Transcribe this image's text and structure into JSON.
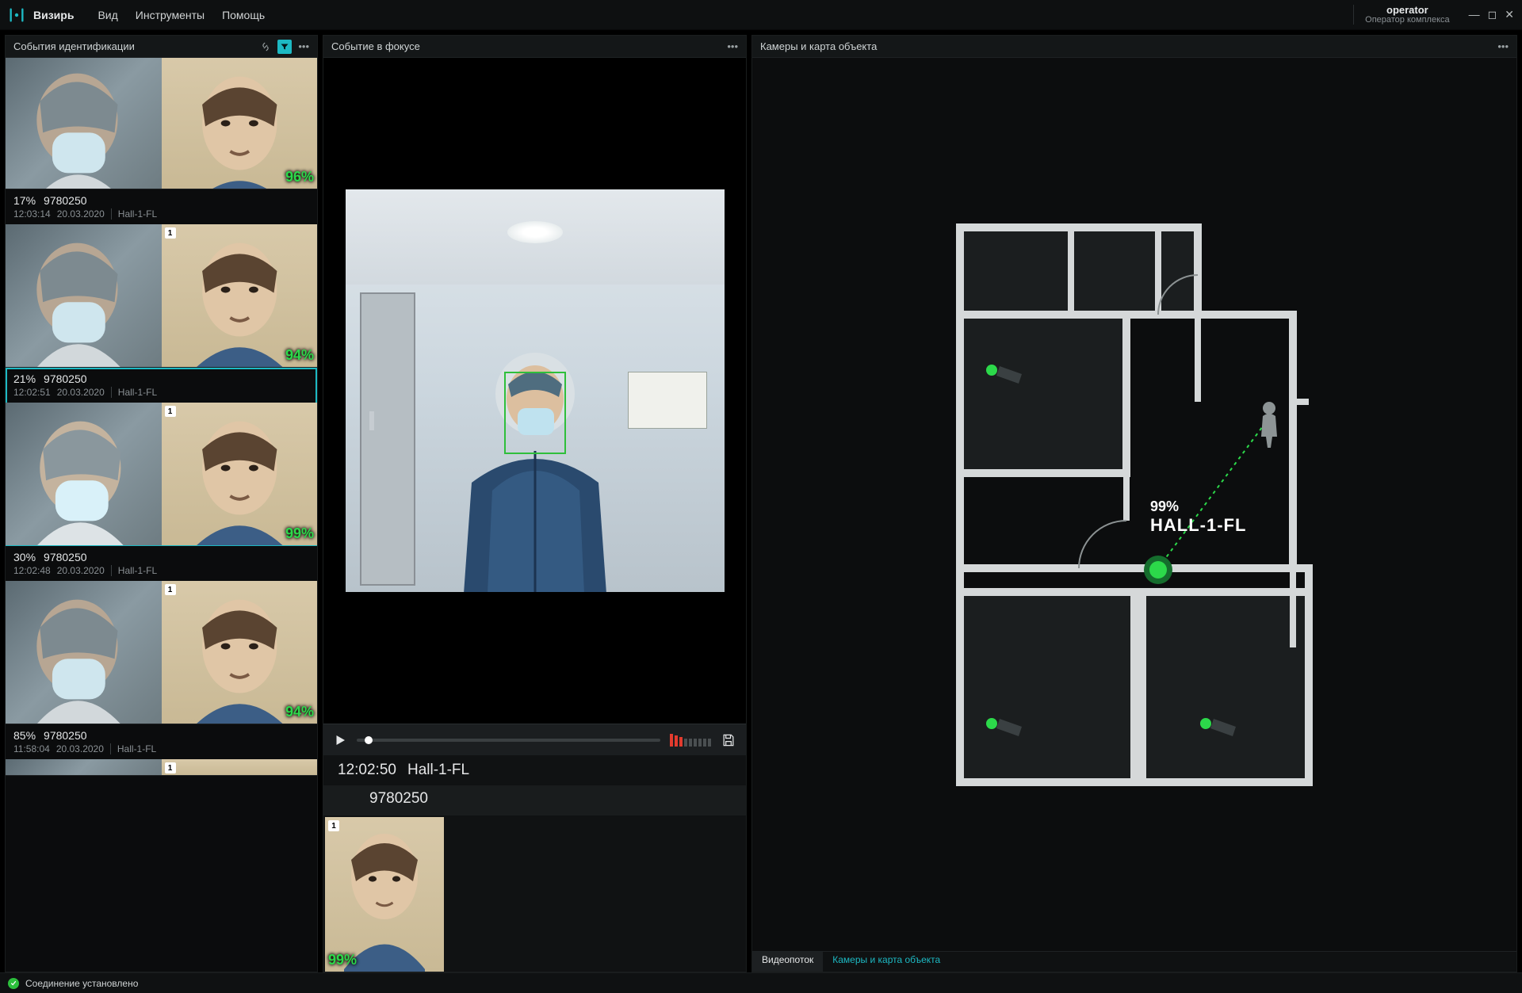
{
  "app": {
    "name": "Визирь"
  },
  "menu": {
    "view": "Вид",
    "tools": "Инструменты",
    "help": "Помощь"
  },
  "user": {
    "name": "operator",
    "role": "Оператор комплекса"
  },
  "panels": {
    "events_title": "События идентификации",
    "focus_title": "Событие в фокусе",
    "map_title": "Камеры и карта объекта"
  },
  "events": [
    {
      "pct": "",
      "uid": "",
      "time": "",
      "date": "",
      "camera": "",
      "match": "96%"
    },
    {
      "pct": "17%",
      "uid": "9780250",
      "time": "12:03:14",
      "date": "20.03.2020",
      "camera": "Hall-1-FL",
      "match": "94%"
    },
    {
      "pct": "21%",
      "uid": "9780250",
      "time": "12:02:51",
      "date": "20.03.2020",
      "camera": "Hall-1-FL",
      "match": "99%"
    },
    {
      "pct": "30%",
      "uid": "9780250",
      "time": "12:02:48",
      "date": "20.03.2020",
      "camera": "Hall-1-FL",
      "match": "94%"
    },
    {
      "pct": "85%",
      "uid": "9780250",
      "time": "11:58:04",
      "date": "20.03.2020",
      "camera": "Hall-1-FL",
      "match": ""
    }
  ],
  "focus": {
    "time": "12:02:50",
    "camera": "Hall-1-FL",
    "uid": "9780250",
    "match": "99%"
  },
  "map": {
    "marker_pct": "99%",
    "marker_label": "HALL-1-FL",
    "tab_stream": "Видеопоток",
    "tab_map": "Камеры и карта объекта"
  },
  "status": {
    "text": "Соединение установлено"
  }
}
